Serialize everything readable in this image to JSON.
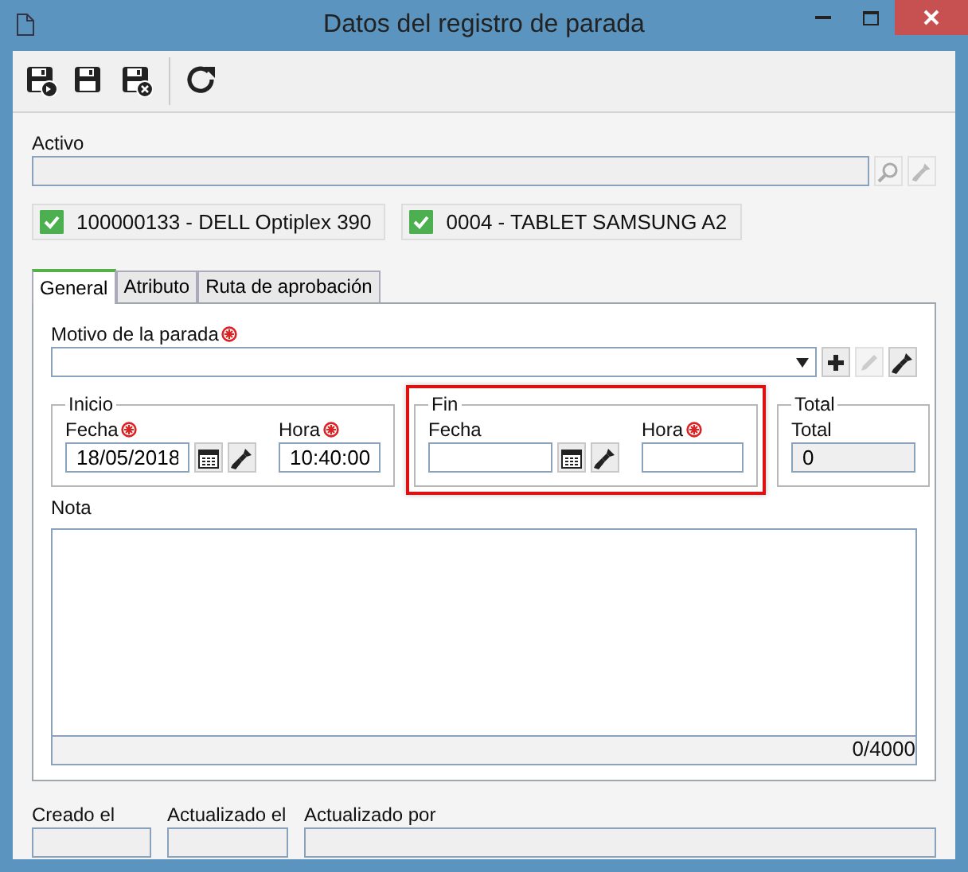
{
  "window": {
    "title": "Datos del registro de parada"
  },
  "toolbar": {
    "buttons": [
      {
        "kind": "save-new"
      },
      {
        "kind": "save"
      },
      {
        "kind": "save-close"
      },
      {
        "kind": "separator"
      },
      {
        "kind": "refresh"
      }
    ]
  },
  "activo": {
    "label": "Activo"
  },
  "assets": [
    {
      "label": "100000133 - DELL Optiplex 390",
      "checked": true
    },
    {
      "label": "0004 - TABLET SAMSUNG A2",
      "checked": true
    }
  ],
  "tabs": [
    {
      "label": "General",
      "selected": true
    },
    {
      "label": "Atributo",
      "selected": false
    },
    {
      "label": "Ruta de aprobación",
      "selected": false
    }
  ],
  "motivo": {
    "label": "Motivo de la parada",
    "required": true
  },
  "inicio": {
    "legend": "Inicio",
    "highlighted": false,
    "fecha": {
      "label": "Fecha",
      "required": true,
      "value": "18/05/2018"
    },
    "hora": {
      "label": "Hora",
      "required": true,
      "value": "10:40:00"
    }
  },
  "fin": {
    "legend": "Fin",
    "highlighted": true,
    "fecha": {
      "label": "Fecha",
      "required": false
    },
    "hora": {
      "label": "Hora",
      "required": true
    }
  },
  "total": {
    "legend": "Total",
    "label": "Total",
    "value": "0"
  },
  "nota": {
    "label": "Nota",
    "counter": "0/4000"
  },
  "footer": [
    {
      "label": "Creado el"
    },
    {
      "label": "Actualizado el"
    },
    {
      "label": "Actualizado por"
    }
  ]
}
